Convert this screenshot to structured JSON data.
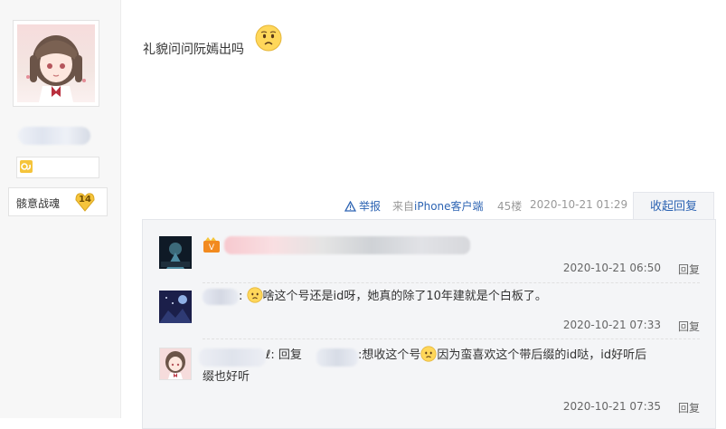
{
  "post": {
    "text": "礼貌问问阮嫣出吗",
    "emoji": "crying-smiley-icon"
  },
  "author": {
    "title": "骸意战魂",
    "level": "14"
  },
  "tail": {
    "report": "举报",
    "source_prefix": "来自",
    "source_client": "iPhone客户端",
    "floor": "45楼",
    "time": "2020-10-21 01:29",
    "collapse": "收起回复"
  },
  "replies": [
    {
      "time": "2020-10-21 06:50",
      "reply_label": "回复"
    },
    {
      "sep": ":",
      "text": "啥这个号还是id呀，她真的除了10年建就是个白板了。",
      "time": "2020-10-21 07:33",
      "reply_label": "回复"
    },
    {
      "user_suffix": "ℓ",
      "sep": ":",
      "reply_word": "回复",
      "text_a": ":想收这个号",
      "text_b": "因为蛮喜欢这个带后缀的id哒，id好听后",
      "text_c": "缀也好听",
      "time": "2020-10-21 07:35",
      "reply_label": "回复"
    }
  ],
  "colors": {
    "link": "#2d64b3",
    "sidebar_bg": "#f7f7f7",
    "reply_bg": "#f4f5f7"
  }
}
